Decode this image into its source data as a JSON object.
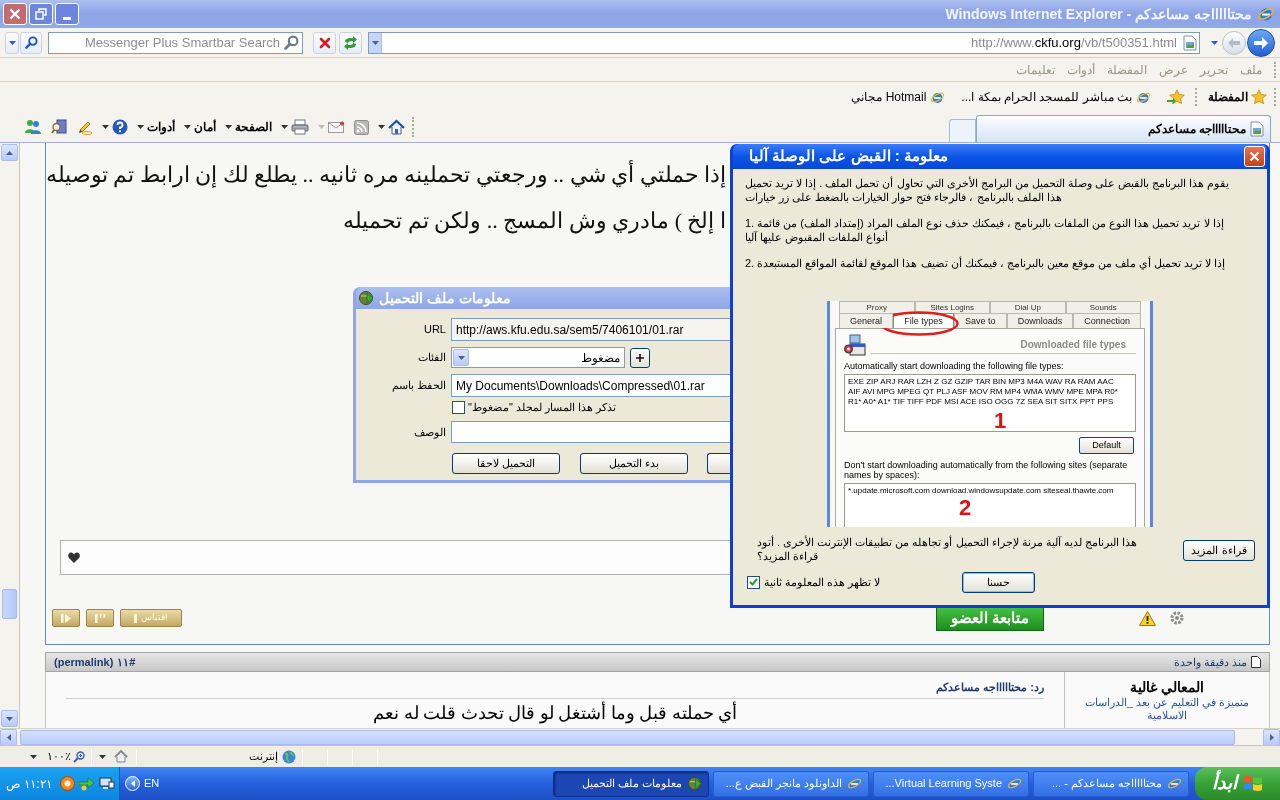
{
  "window": {
    "title": "محتاااااجه مساعدكم - Windows Internet Explorer"
  },
  "search_box": {
    "placeholder": "Messenger Plus Smartbar Search"
  },
  "address_bar": {
    "url": "http://www.ckfu.org/vb/t500351.html"
  },
  "menu_bar": [
    "ملف",
    "تحرير",
    "عرض",
    "المفضلة",
    "أدوات",
    "تعليمات"
  ],
  "favorites_bar": {
    "label": "المفضلة",
    "links": [
      "بث مباشر للمسجد الحرام بمكة ا...",
      "Hotmail مجاني"
    ]
  },
  "tabs": [
    {
      "label": "محتاااااجه مساعدكم",
      "selected": true
    }
  ],
  "command_bar": [
    "الصفحة",
    "أمان",
    "أدوات"
  ],
  "page": {
    "text_lines": [
      "إذا حملتي أي شي .. ورجعتي تحملينه مره ثانيه .. يطلع لك إن ارابط تم توصيله",
      "ا إلخ ) مادري وش المسج .. ولكن تم تحميله"
    ],
    "post_buttons": [
      "اقتباس"
    ],
    "follow_button": "متابعة العضو",
    "post": {
      "time": "منذ دقيقة واحدة",
      "number": "#١١",
      "permalink": "(permalink)",
      "author": "المعالي غالية",
      "author_title": "متميزة في التعليم عن بعد _الدراسات الاسلامية",
      "title": "رد: محتاااااجه مساعدكم",
      "body": "أي حملته قبل وما أشتغل لو قال تحدث قلت له نعم"
    }
  },
  "download_dialog": {
    "title": "معلومات ملف التحميل",
    "url_label": "URL",
    "url": "http://aws.kfu.edu.sa/sem5/7406101/01.rar",
    "category_label": "الفئات",
    "category": "مضغوط",
    "save_label": "الحفظ باسم",
    "save_path": "My Documents\\Downloads\\Compressed\\01.rar",
    "remember": {
      "label": "تذكر هذا المسار لمجلد \"مضغوط\"",
      "checked": false
    },
    "description_label": "الوصف",
    "buttons": [
      "بدء التحميل",
      "التحميل لاحقا"
    ]
  },
  "info_dialog": {
    "title": "معلومة : القبض على الوصلة آليا",
    "paragraphs": [
      "يقوم هذا البرنامج بالقبض على وصلة التحميل من البرامج الأخرى التي تحاول أن تحمل الملف . إذا لا تريد تحميل هذا الملف بالبرنامج ، فالرجاء فتح حوار الخيارات بالضغط على زر خيارات",
      "1. إذا لا تريد تحميل هذا النوع من الملفات بالبرنامج ، فيمكنك حذف نوع الملف المراد (إمتداد الملف) من قائمة أنواع الملفات المقبوض عليها آليا",
      "2. إذا لا تريد تحميل أي ملف من موقع معين بالبرنامج ، فيمكنك أن تضيف هذا الموقع لقائمة المواقع المستبعدة"
    ],
    "inset": {
      "upper_tabs": [
        "Sounds",
        "Dial Up",
        "Sites Logins",
        "Proxy"
      ],
      "tabs": [
        {
          "label": "Connection",
          "selected": false,
          "circled": false
        },
        {
          "label": "Downloads",
          "selected": false,
          "circled": false
        },
        {
          "label": "Save to",
          "selected": false,
          "circled": false
        },
        {
          "label": "File types",
          "selected": true,
          "circled": true
        },
        {
          "label": "General",
          "selected": false,
          "circled": false
        }
      ],
      "heading": "Downloaded file types",
      "auto_label": "Automatically start downloading the following file types:",
      "file_types": "EXE ZIP ARJ RAR LZH Z GZ GZIP TAR BIN MP3 M4A WAV RA RAM AAC AIF AVI MPG MPEG QT PLJ ASF MOV RM MP4 WMA WMV MPE MPA R0* R1* A0* A1* TIF TIFF PDF MSI ACE ISO OGG 7Z SEA SIT SITX PPT PPS",
      "default_button": "Default",
      "exclude_label": "Don't start downloading automatically from the following sites (separate names by spaces):",
      "excluded_sites": "*.update.microsoft.com download.windowsupdate.com siteseal.thawte.com",
      "markers": [
        "1",
        "2"
      ]
    },
    "footer_text": "هذا البرنامج لديه آلية مرنة لإجراء التحميل أو تجاهله من تطبيقات الإنترنت الأخرى . أتود قراءة المزيد؟",
    "more_button": "قراءة المزيد",
    "dont_show": {
      "label": "لا تظهر هذه المعلومة ثانية",
      "checked": true
    },
    "ok_button": "حسنا"
  },
  "status_bar": {
    "zone": "إنترنت",
    "zoom": "١٠٠٪"
  },
  "taskbar": {
    "start": "ابدأ",
    "tasks": [
      {
        "label": "محتاااااجه مساعدكم - ...",
        "kind": "browser",
        "selected": false
      },
      {
        "label": "Virtual Learning Syste...",
        "kind": "browser",
        "selected": false
      },
      {
        "label": "الداونلود مانجر القبض ع...",
        "kind": "browser",
        "selected": false
      },
      {
        "label": "معلومات ملف التحميل",
        "kind": "downloader",
        "selected": true
      }
    ],
    "language": "EN",
    "clock": "١١:٢١ ص"
  }
}
